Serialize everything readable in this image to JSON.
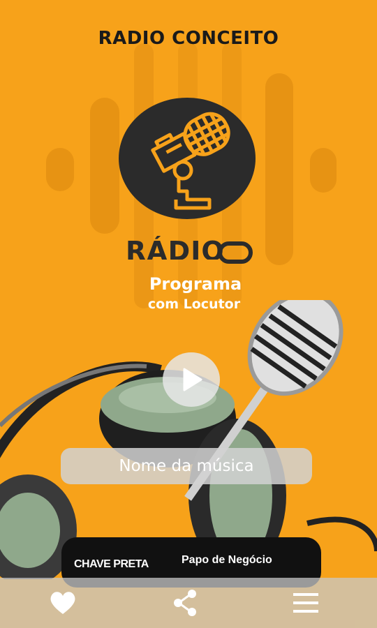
{
  "header": {
    "title": "RADIO CONCEITO"
  },
  "logo": {
    "text": "RÁDIO"
  },
  "program": {
    "name": "Programa",
    "host": "com Locutor"
  },
  "player": {
    "song_name": "Nome da música",
    "play_icon": "play-icon"
  },
  "sponsors": {
    "left": "CHAVE PRETA",
    "right": "Papo de Negócio"
  },
  "nav": {
    "icons": [
      "heart-icon",
      "share-icon",
      "menu-icon"
    ]
  },
  "colors": {
    "background": "#f7a21a",
    "logo_bg": "#2b2b2b",
    "accent": "#f7a21a"
  }
}
